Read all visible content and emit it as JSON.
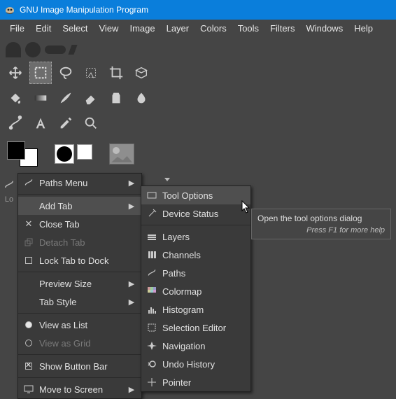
{
  "window": {
    "title": "GNU Image Manipulation Program"
  },
  "menubar": [
    "File",
    "Edit",
    "Select",
    "View",
    "Image",
    "Layer",
    "Colors",
    "Tools",
    "Filters",
    "Windows",
    "Help"
  ],
  "dock": {
    "lock_abbrev": "Lo"
  },
  "context_menu": {
    "items": [
      {
        "label": "Paths Menu",
        "icon": "paths",
        "submenu": true
      },
      {
        "label": "Add Tab",
        "submenu": true,
        "highlight": true
      },
      {
        "label": "Close Tab",
        "icon": "close"
      },
      {
        "label": "Detach Tab",
        "icon": "detach",
        "disabled": true
      },
      {
        "label": "Lock Tab to Dock",
        "check": false
      },
      {
        "label": "Preview Size",
        "submenu": true
      },
      {
        "label": "Tab Style",
        "submenu": true
      },
      {
        "label": "View as List",
        "radio": true
      },
      {
        "label": "View as Grid",
        "radio": false,
        "disabled": true
      },
      {
        "label": "Show Button Bar",
        "check": true
      },
      {
        "label": "Move to Screen",
        "icon": "screen",
        "submenu": true
      }
    ]
  },
  "add_tab_submenu": [
    {
      "label": "Tool Options",
      "icon": "tool-options",
      "highlight": true
    },
    {
      "label": "Device Status",
      "icon": "device-status"
    },
    {
      "label": "Layers",
      "icon": "layers"
    },
    {
      "label": "Channels",
      "icon": "channels"
    },
    {
      "label": "Paths",
      "icon": "paths"
    },
    {
      "label": "Colormap",
      "icon": "colormap"
    },
    {
      "label": "Histogram",
      "icon": "histogram"
    },
    {
      "label": "Selection Editor",
      "icon": "selection-editor"
    },
    {
      "label": "Navigation",
      "icon": "navigation"
    },
    {
      "label": "Undo History",
      "icon": "undo-history"
    },
    {
      "label": "Pointer",
      "icon": "pointer"
    }
  ],
  "tooltip": {
    "line1": "Open the tool options dialog",
    "line2": "Press F1 for more help"
  }
}
